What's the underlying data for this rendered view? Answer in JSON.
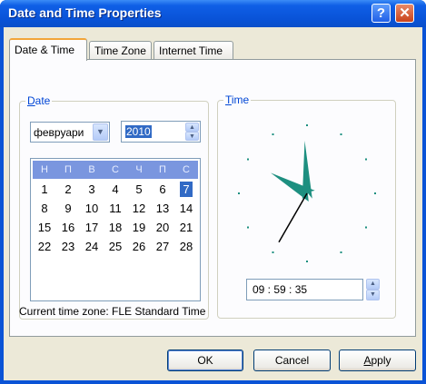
{
  "window": {
    "title": "Date and Time Properties",
    "help_glyph": "?",
    "close_glyph": "✕"
  },
  "tabs": [
    {
      "label": "Date & Time",
      "active": true
    },
    {
      "label": "Time Zone",
      "active": false
    },
    {
      "label": "Internet Time",
      "active": false
    }
  ],
  "date_group": {
    "label_prefix": "D",
    "label_rest": "ate",
    "month": "февруари",
    "year": "2010",
    "weekdays": [
      "Н",
      "П",
      "В",
      "С",
      "Ч",
      "П",
      "С"
    ],
    "weeks": [
      [
        "1",
        "2",
        "3",
        "4",
        "5",
        "6",
        "7"
      ],
      [
        "8",
        "9",
        "10",
        "11",
        "12",
        "13",
        "14"
      ],
      [
        "15",
        "16",
        "17",
        "18",
        "19",
        "20",
        "21"
      ],
      [
        "22",
        "23",
        "24",
        "25",
        "26",
        "27",
        "28"
      ]
    ],
    "selected_day": "7"
  },
  "time_group": {
    "label_prefix": "T",
    "label_rest": "ime",
    "time_text": "09 : 59 : 35",
    "clock": {
      "hour": 9,
      "minute": 59,
      "second": 35
    }
  },
  "timezone_line": "Current time zone:  FLE Standard Time",
  "buttons": {
    "ok": "OK",
    "cancel": "Cancel",
    "apply_prefix": "A",
    "apply_rest": "pply"
  },
  "colors": {
    "title_blue": "#0a53d6",
    "clock_hands": "#1d8f80",
    "selection": "#316ac5"
  }
}
